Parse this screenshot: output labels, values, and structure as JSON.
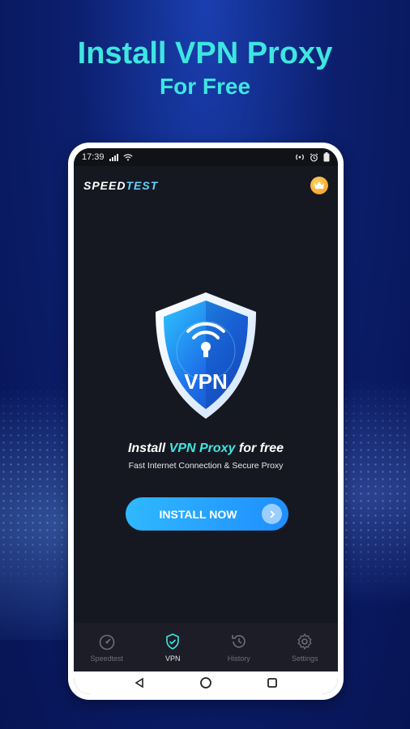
{
  "headline": {
    "line1": "Install VPN Proxy",
    "line2": "For Free"
  },
  "statusbar": {
    "time": "17:39"
  },
  "app": {
    "logo_part1": "SPEED",
    "logo_part2": "TEST"
  },
  "shield": {
    "label": "VPN"
  },
  "promo": {
    "title_prefix": "Install ",
    "title_highlight": "VPN Proxy",
    "title_suffix": " for free",
    "subtitle": "Fast Internet Connection & Secure Proxy"
  },
  "install_button": {
    "label": "INSTALL NOW"
  },
  "bottom_nav": {
    "items": [
      {
        "label": "Speedtest",
        "icon": "speedometer-icon",
        "active": false
      },
      {
        "label": "VPN",
        "icon": "shield-check-icon",
        "active": true
      },
      {
        "label": "History",
        "icon": "history-icon",
        "active": false
      },
      {
        "label": "Settings",
        "icon": "gear-icon",
        "active": false
      }
    ]
  },
  "colors": {
    "accent": "#3ee6e0",
    "button": "#1f8fff",
    "background": "#0c1f6e",
    "screen": "#161821"
  }
}
